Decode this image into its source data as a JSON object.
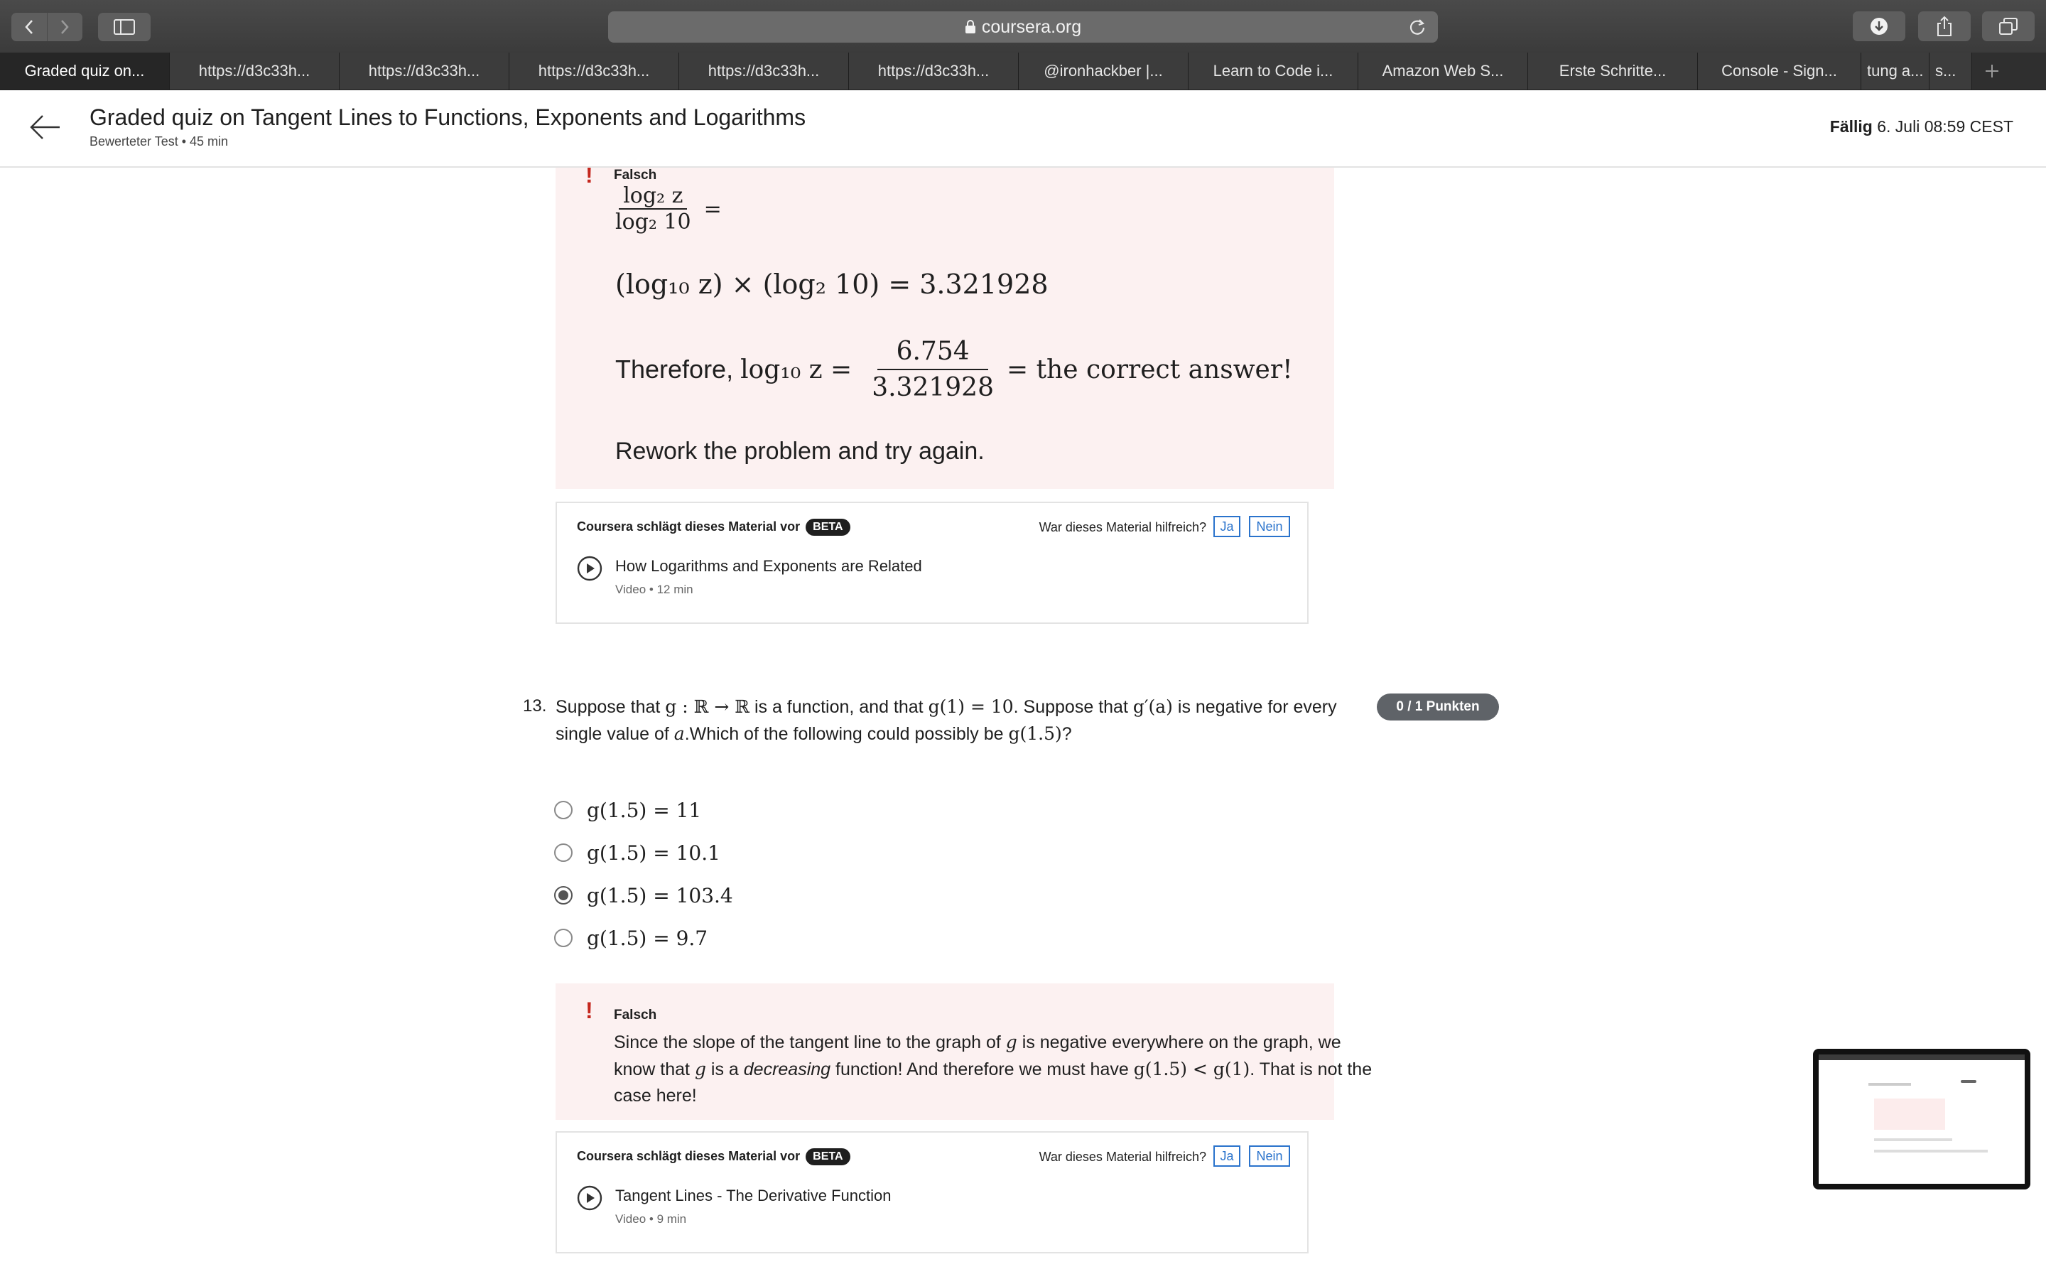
{
  "browser": {
    "url": "coursera.org",
    "tabs": [
      {
        "label": "Graded quiz on...",
        "active": true
      },
      {
        "label": "https://d3c33h..."
      },
      {
        "label": "https://d3c33h..."
      },
      {
        "label": "https://d3c33h..."
      },
      {
        "label": "https://d3c33h..."
      },
      {
        "label": "https://d3c33h..."
      },
      {
        "label": "@ironhackber |..."
      },
      {
        "label": "Learn to Code i..."
      },
      {
        "label": "Amazon Web S..."
      },
      {
        "label": "Erste Schritte..."
      },
      {
        "label": "Console - Sign..."
      },
      {
        "label": "tung a..."
      },
      {
        "label": "s..."
      }
    ]
  },
  "header": {
    "title": "Graded quiz on Tangent Lines to Functions, Exponents and Logarithms",
    "subtitle": "Bewerteter Test • 45 min",
    "due_label": "Fällig",
    "due_value": "6. Juli 08:59 CEST"
  },
  "feedback1": {
    "status": "Falsch",
    "frac_num": "log₂ z",
    "frac_den": "log₂ 10",
    "frac_eq": "=",
    "line2": "(log₁₀ z) × (log₂ 10) = 3.321928",
    "line3_prefix": "Therefore, ",
    "line3_lhs": "log₁₀ z =",
    "line3_num": "6.754",
    "line3_den": "3.321928",
    "line3_suffix": "= the correct answer!",
    "line4": "Rework the problem and try again."
  },
  "suggestion1": {
    "heading": "Coursera schlägt dieses Material vor",
    "beta": "BETA",
    "question": "War dieses Material hilfreich?",
    "yes": "Ja",
    "no": "Nein",
    "title": "How Logarithms and Exponents are Related",
    "meta": "Video • 12 min"
  },
  "question13": {
    "number": "13.",
    "t1": "Suppose that ",
    "m1": "g : ℝ → ℝ",
    "t2": " is a function, and that ",
    "m2": "g(1) = 10",
    "t3": ". Suppose that ",
    "m3": "g′(a)",
    "t4": " is negative for every single value of ",
    "m4": "a",
    "t5": ".Which of the following could possibly be ",
    "m5": "g(1.5)",
    "t6": "?",
    "points": "0 / 1 Punkten",
    "options": [
      {
        "label": "g(1.5) = 11",
        "selected": false
      },
      {
        "label": "g(1.5) = 10.1",
        "selected": false
      },
      {
        "label": "g(1.5) = 103.4",
        "selected": true
      },
      {
        "label": "g(1.5) = 9.7",
        "selected": false
      }
    ]
  },
  "feedback2": {
    "status": "Falsch",
    "t1": "Since the slope of the tangent line to the graph of ",
    "m1": "g",
    "t2": " is negative everywhere on the graph, we know that ",
    "m2": "g",
    "t3": " is a ",
    "em": "decreasing",
    "t4": " function! And therefore we must have ",
    "m3": "g(1.5) < g(1)",
    "t5": ". That is not the case here!"
  },
  "suggestion2": {
    "heading": "Coursera schlägt dieses Material vor",
    "beta": "BETA",
    "question": "War dieses Material hilfreich?",
    "yes": "Ja",
    "no": "Nein",
    "title": "Tangent Lines - The Derivative Function",
    "meta": "Video • 9 min"
  }
}
